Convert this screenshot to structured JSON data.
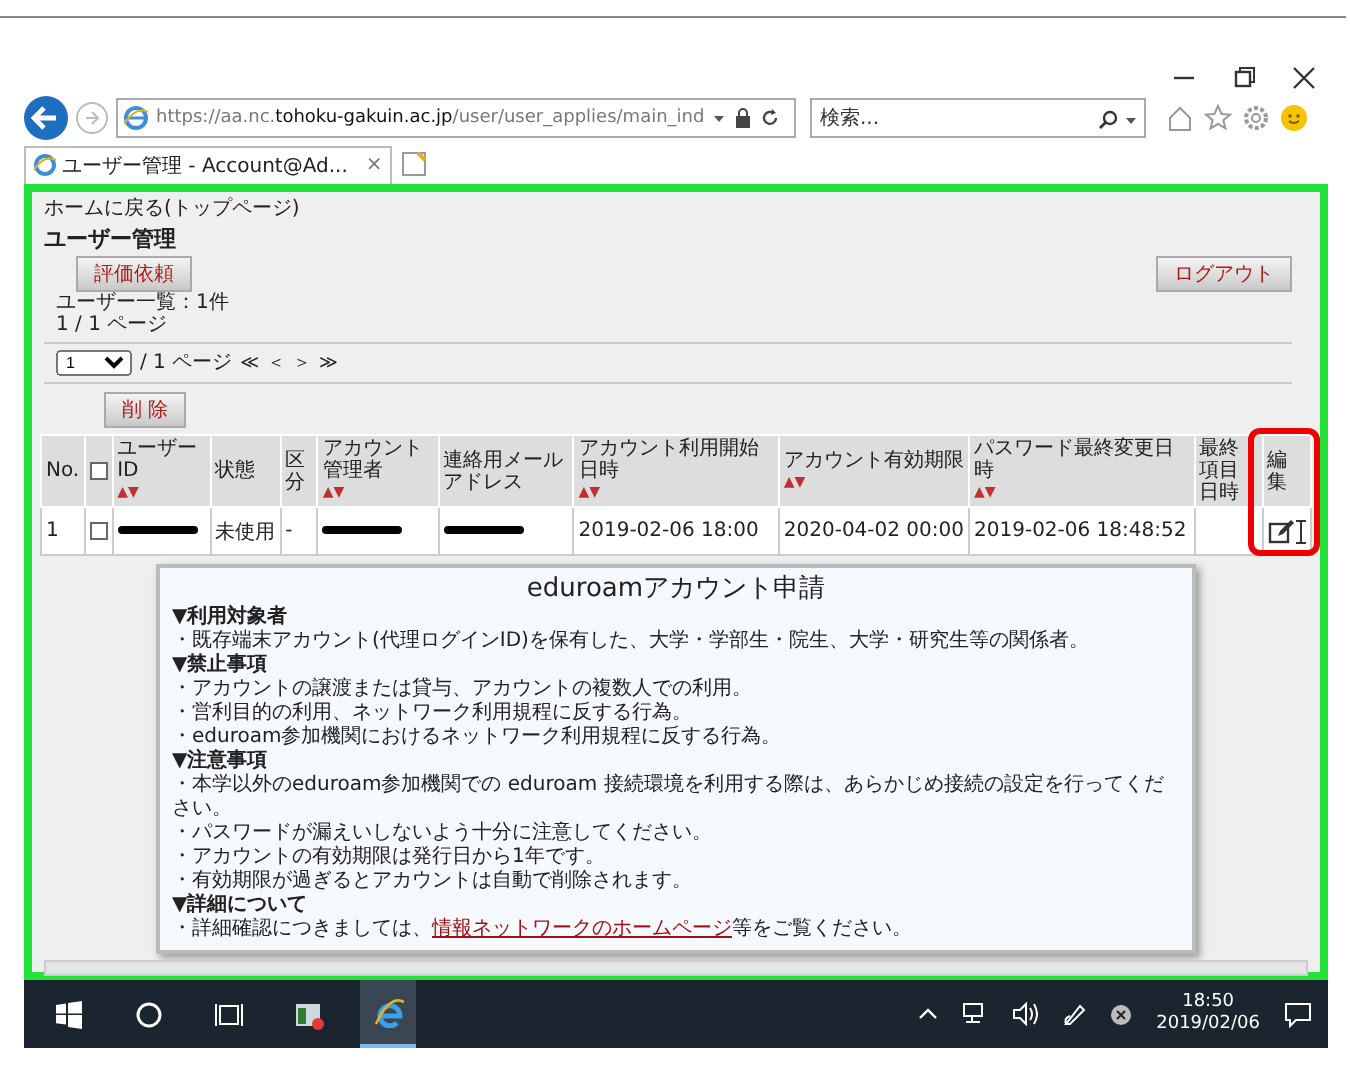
{
  "browser": {
    "url": "https://aa.nc.**tohoku-gakuin.ac.jp**/user/user_applies/main_ind",
    "search_placeholder": "検索...",
    "tabs": [
      {
        "title": "ユーザー管理 - Account@Ad...",
        "close": "×",
        "selected": true
      }
    ]
  },
  "page": {
    "top_link": "ホームに戻る(トップページ)",
    "heading": "ユーザー管理",
    "request_button": "評価依頼",
    "logout_button": "ログアウト",
    "count": "ユーザー一覧：1件",
    "pages": "1 / 1 ページ",
    "pager": {
      "page_value": "1",
      "total": "/ 1 ページ",
      "nav": [
        "≪",
        "＜",
        "＞",
        "≫"
      ]
    },
    "delete_button": "削 除",
    "table": {
      "columns": [
        {
          "label": "No."
        },
        {
          "kind": "checkbox",
          "checked": false
        },
        {
          "label": "ユーザーID",
          "sort": "▲▼"
        },
        {
          "label": "状態"
        },
        {
          "label": "区分"
        },
        {
          "label": "アカウント管理者",
          "sort": "▲▼"
        },
        {
          "label": "連絡用メールアドレス"
        },
        {
          "label": "アカウント利用開始日時",
          "sort": "▲▼"
        },
        {
          "label": "アカウント有効期限",
          "sort": "▲▼"
        },
        {
          "label": "パスワード最終変更日時",
          "sort": "▲▼"
        },
        {
          "label": "最終項目日時"
        },
        {
          "label": "編集"
        }
      ],
      "rows": [
        {
          "cells": [
            {
              "kind": "text",
              "text": "1"
            },
            {
              "kind": "checkbox",
              "checked": false
            },
            {
              "kind": "redacted"
            },
            {
              "kind": "text",
              "text": "未使用"
            },
            {
              "kind": "text",
              "text": "-"
            },
            {
              "kind": "redacted"
            },
            {
              "kind": "redacted"
            },
            {
              "kind": "text",
              "text": "2019-02-06 18:00"
            },
            {
              "kind": "text",
              "text": "2020-04-02 00:00"
            },
            {
              "kind": "text",
              "text": "2019-02-06 18:48:52"
            },
            {
              "kind": "empty"
            },
            {
              "kind": "edit"
            }
          ]
        }
      ]
    },
    "popup": {
      "title": "eduroamアカウント申請",
      "sections": [
        {
          "heading": "▼利用対象者",
          "items": [
            "・既存端末アカウント(代理ログインID)を保有した、大学・学部生・院生、大学・研究生等の関係者。"
          ]
        },
        {
          "heading": "▼禁止事項",
          "items": [
            "・アカウントの譲渡または貸与、アカウントの複数人での利用。",
            "・営利目的の利用、ネットワーク利用規程に反する行為。",
            "・eduroam参加機関におけるネットワーク利用規程に反する行為。"
          ]
        },
        {
          "heading": "▼注意事項",
          "items": [
            "・本学以外のeduroam参加機関での eduroam 接続環境を利用する際は、あらかじめ接続の設定を行ってください。",
            "・パスワードが漏えいしないよう十分に注意してください。",
            "・アカウントの有効期限は発行日から1年です。",
            "・有効期限が過ぎるとアカウントは自動で削除されます。"
          ]
        },
        {
          "heading": "▼詳細について",
          "items": [
            {
              "before": "・詳細確認につきましては、",
              "link": "情報ネットワークのホームページ",
              "after": "等をご覧ください。"
            }
          ]
        }
      ]
    }
  },
  "taskbar": {
    "apps": [
      {
        "kind": "start"
      },
      {
        "kind": "search"
      },
      {
        "kind": "taskview"
      },
      {
        "kind": "app",
        "selected": false
      },
      {
        "kind": "browser",
        "selected": true
      }
    ],
    "time": "18:50",
    "date": "2019/02/06"
  }
}
